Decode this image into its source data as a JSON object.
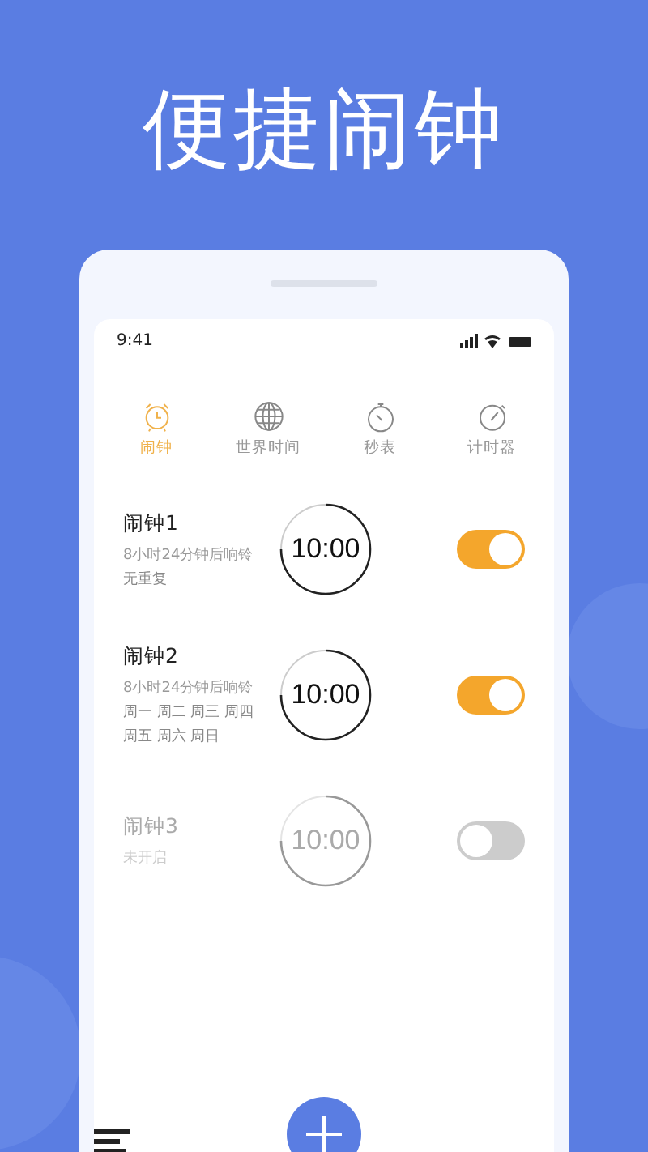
{
  "headline": "便捷闹钟",
  "status_bar": {
    "time": "9:41"
  },
  "tabs": [
    {
      "label": "闹钟",
      "selected": true
    },
    {
      "label": "世界时间",
      "selected": false
    },
    {
      "label": "秒表",
      "selected": false
    },
    {
      "label": "计时器",
      "selected": false
    }
  ],
  "alarms": [
    {
      "name": "闹钟1",
      "time": "10:00",
      "note": "8小时24分钟后响铃",
      "repeat": [
        "无重复"
      ],
      "on": true
    },
    {
      "name": "闹钟2",
      "time": "10:00",
      "note": "8小时24分钟后响铃",
      "repeat": [
        "周一 周二 周三 周四",
        "周五 周六 周日"
      ],
      "on": true
    },
    {
      "name": "闹钟3",
      "time": "10:00",
      "note": "未开启",
      "on": false
    }
  ]
}
